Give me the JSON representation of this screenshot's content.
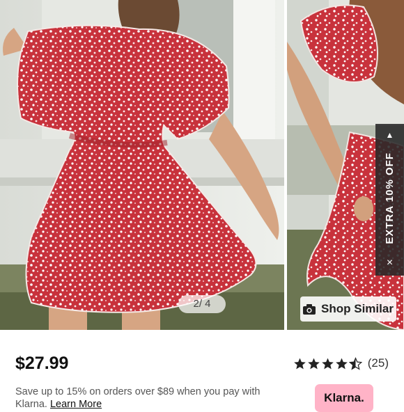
{
  "gallery": {
    "counter": "2/ 4",
    "shop_similar_label": "Shop Similar",
    "promo_label": "EXTRA 10% OFF",
    "promo_arrow": "▲",
    "promo_close": "×"
  },
  "product": {
    "price": "$27.99",
    "rating_value": 4.5,
    "rating_count": "(25)"
  },
  "klarna": {
    "note": "Save up to 15% on orders over $89 when you pay with Klarna.",
    "learn_more": "Learn More",
    "badge_label": "Klarna."
  },
  "colors": {
    "dress_red": "#c8323c",
    "klarna_pink": "#ffb3c7",
    "promo_tab": "#282828"
  }
}
